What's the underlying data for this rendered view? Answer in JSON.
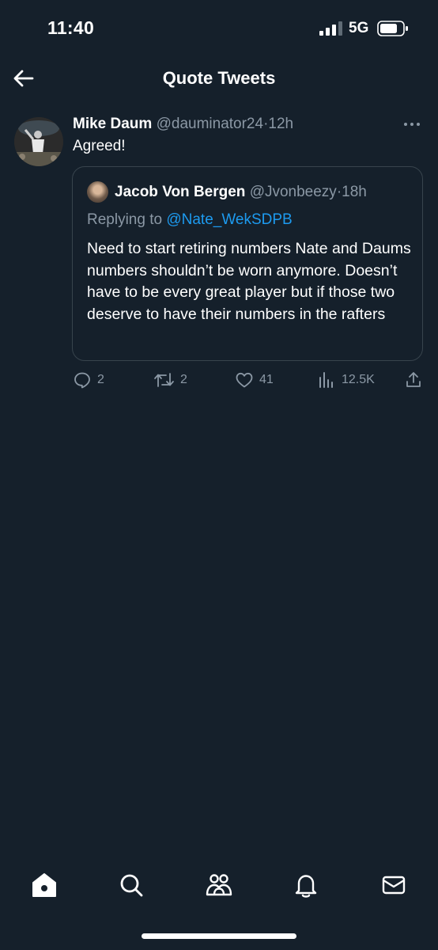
{
  "status_bar": {
    "time": "11:40",
    "network": "5G"
  },
  "header": {
    "title": "Quote Tweets",
    "back_icon": "arrow-left-icon"
  },
  "tweet": {
    "author_name": "Mike Daum",
    "author_handle": "@dauminator24",
    "separator": "·",
    "time": "12h",
    "text": "Agreed!",
    "quoted": {
      "author_name": "Jacob Von Bergen",
      "author_handle": "@Jvonbeezy",
      "separator": "·",
      "time": "18h",
      "replying_prefix": "Replying to ",
      "replying_to": "@Nate_WekSDPB",
      "text": "Need to start retiring numbers Nate and Daums numbers shouldn’t be worn anymore. Doesn’t have to be every great player but if those two deserve to have their numbers in the rafters"
    },
    "actions": {
      "replies": "2",
      "retweets": "2",
      "likes": "41",
      "views": "12.5K"
    }
  },
  "nav": {
    "items": [
      "home-icon",
      "search-icon",
      "communities-icon",
      "notifications-icon",
      "messages-icon"
    ]
  },
  "colors": {
    "background": "#15202b",
    "muted_text": "#8b98a5",
    "link": "#1d9bf0",
    "border": "#38444d"
  }
}
